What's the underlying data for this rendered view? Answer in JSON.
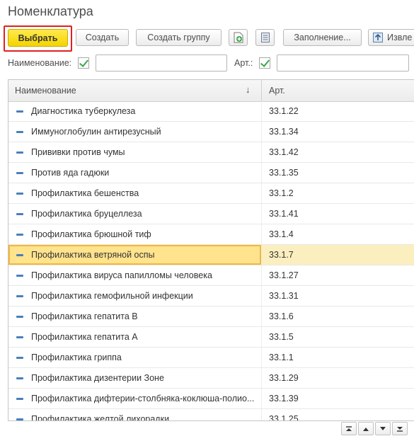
{
  "window": {
    "title": "Номенклатура"
  },
  "toolbar": {
    "select_label": "Выбрать",
    "create_label": "Создать",
    "create_group_label": "Создать группу",
    "fill_label": "Заполнение...",
    "extract_label": "Извле"
  },
  "filters": {
    "name_label": "Наименование:",
    "art_label": "Арт.:",
    "name_value": "",
    "art_value": ""
  },
  "table": {
    "columns": [
      "Наименование",
      "Арт."
    ],
    "sort_indicator": "↓",
    "rows": [
      {
        "name": "Диагностика туберкулеза",
        "art": "33.1.22"
      },
      {
        "name": "Иммуноглобулин антирезусный",
        "art": "33.1.34"
      },
      {
        "name": "Прививки против чумы",
        "art": "33.1.42"
      },
      {
        "name": "Против яда гадюки",
        "art": "33.1.35"
      },
      {
        "name": "Профилактика бешенства",
        "art": "33.1.2"
      },
      {
        "name": "Профилактика бруцеллеза",
        "art": "33.1.41"
      },
      {
        "name": "Профилактика брюшной тиф",
        "art": "33.1.4"
      },
      {
        "name": "Профилактика ветряной оспы",
        "art": "33.1.7",
        "selected": true
      },
      {
        "name": "Профилактика вируса папилломы человека",
        "art": "33.1.27"
      },
      {
        "name": "Профилактика гемофильной инфекции",
        "art": "33.1.31"
      },
      {
        "name": "Профилактика гепатита В",
        "art": "33.1.6"
      },
      {
        "name": "Профилактика гепатита А",
        "art": "33.1.5"
      },
      {
        "name": "Профилактика гриппа",
        "art": "33.1.1"
      },
      {
        "name": "Профилактика дизентерии Зоне",
        "art": "33.1.29"
      },
      {
        "name": "Профилактика дифтерии-столбняка-коклюша-полио...",
        "art": "33.1.39"
      },
      {
        "name": "Профилактика желтой лихорадки",
        "art": "33.1.25"
      }
    ]
  },
  "icons": {
    "row_marker": "dash-icon",
    "check_color": "#3aa64a",
    "accent": "#f5d400",
    "highlight_border": "#e02020"
  }
}
